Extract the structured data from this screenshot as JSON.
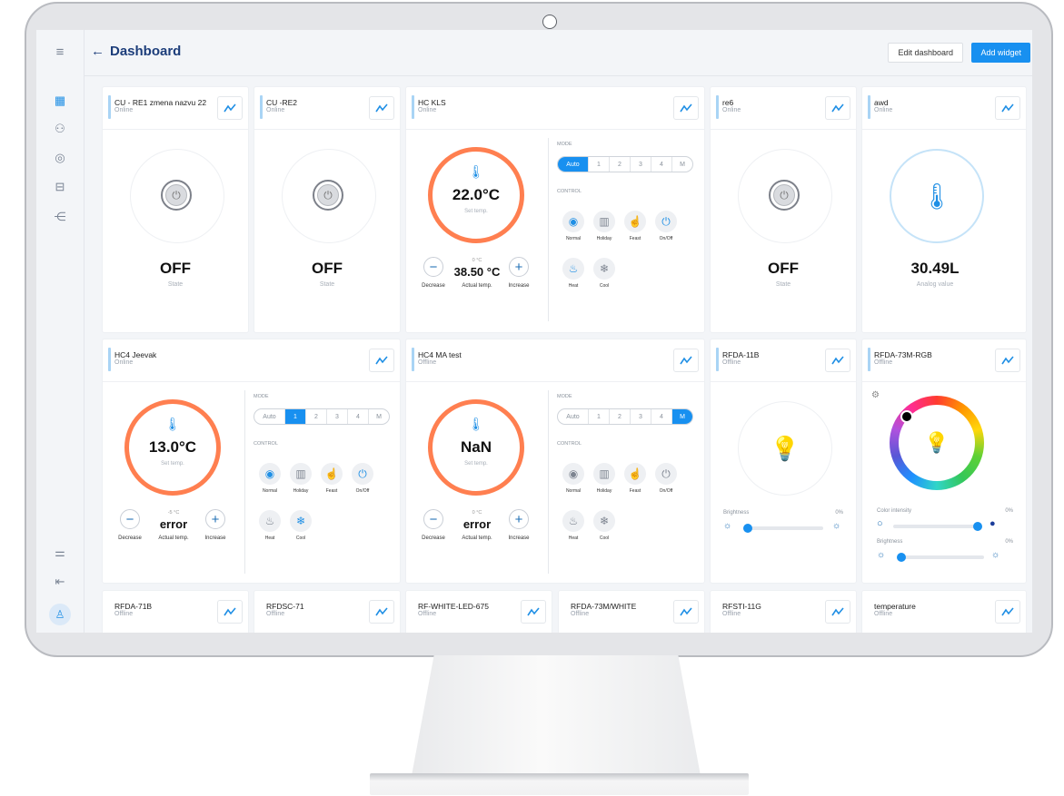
{
  "header": {
    "title": "Dashboard",
    "back_icon": "←",
    "edit_button": "Edit dashboard",
    "add_button": "Add widget"
  },
  "sidebar": {
    "items": [
      "menu-icon",
      "dashboard-icon",
      "devices-icon",
      "sensors-icon",
      "vehicle-icon",
      "share-icon",
      "filter-icon",
      "logout-icon",
      "user-icon"
    ]
  },
  "status": {
    "online": "Online",
    "offline": "Offline"
  },
  "widgets": {
    "cu_re1": {
      "name": "CU - RE1 zmena nazvu 22",
      "status": "Online",
      "value": "OFF",
      "label": "State"
    },
    "cu_re2": {
      "name": "CU -RE2",
      "status": "Online",
      "value": "OFF",
      "label": "State"
    },
    "hc_kls": {
      "name": "HC KLS",
      "status": "Online",
      "set_temp": "22.0°C",
      "set_label": "Set temp.",
      "actual_small": "0 °C",
      "actual": "38.50 °C",
      "actual_label": "Actual temp.",
      "decrease": "Decrease",
      "increase": "Increase",
      "mode_label": "MODE",
      "control_label": "CONTROL",
      "modes": [
        "Auto",
        "1",
        "2",
        "3",
        "4",
        "M"
      ],
      "selected_mode": "Auto",
      "controls": [
        "Normal",
        "Holiday",
        "Feast",
        "On/Off",
        "Heat",
        "Cool"
      ]
    },
    "re6": {
      "name": "re6",
      "status": "Online",
      "value": "OFF",
      "label": "State"
    },
    "awd": {
      "name": "awd",
      "status": "Online",
      "value": "30.49L",
      "label": "Analog value"
    },
    "hc4_jeevak": {
      "name": "HC4 Jeevak",
      "status": "Online",
      "set_temp": "13.0°C",
      "set_label": "Set temp.",
      "actual_small": "-5 °C",
      "actual": "error",
      "actual_label": "Actual temp.",
      "decrease": "Decrease",
      "increase": "Increase",
      "mode_label": "MODE",
      "control_label": "CONTROL",
      "modes": [
        "Auto",
        "1",
        "2",
        "3",
        "4",
        "M"
      ],
      "selected_mode": "1",
      "controls": [
        "Normal",
        "Holiday",
        "Feast",
        "On/Off",
        "Heat",
        "Cool"
      ]
    },
    "hc4_ma": {
      "name": "HC4 MA test",
      "status": "Offline",
      "set_temp": "NaN",
      "set_label": "Set temp.",
      "actual_small": "0 °C",
      "actual": "error",
      "actual_label": "Actual temp.",
      "decrease": "Decrease",
      "increase": "Increase",
      "mode_label": "MODE",
      "control_label": "CONTROL",
      "modes": [
        "Auto",
        "1",
        "2",
        "3",
        "4",
        "M"
      ],
      "selected_mode": "M",
      "controls": [
        "Normal",
        "Holiday",
        "Feast",
        "On/Off",
        "Heat",
        "Cool"
      ]
    },
    "rfda_11b": {
      "name": "RFDA-11B",
      "status": "Offline",
      "brightness_label": "Brightness",
      "brightness": "0%"
    },
    "rfda_73m_rgb": {
      "name": "RFDA-73M-RGB",
      "status": "Offline",
      "intensity_label": "Color intensity",
      "intensity": "0%",
      "brightness_label": "Brightness",
      "brightness": "0%"
    },
    "bottom": [
      {
        "name": "RFDA-71B",
        "status": "Offline"
      },
      {
        "name": "RFDSC-71",
        "status": "Offline"
      },
      {
        "name": "RF-WHITE-LED-675",
        "status": "Offline"
      },
      {
        "name": "RFDA-73M/WHITE",
        "status": "Offline"
      },
      {
        "name": "RFSTI-11G",
        "status": "Offline"
      },
      {
        "name": "temperature",
        "status": "Offline"
      }
    ]
  }
}
